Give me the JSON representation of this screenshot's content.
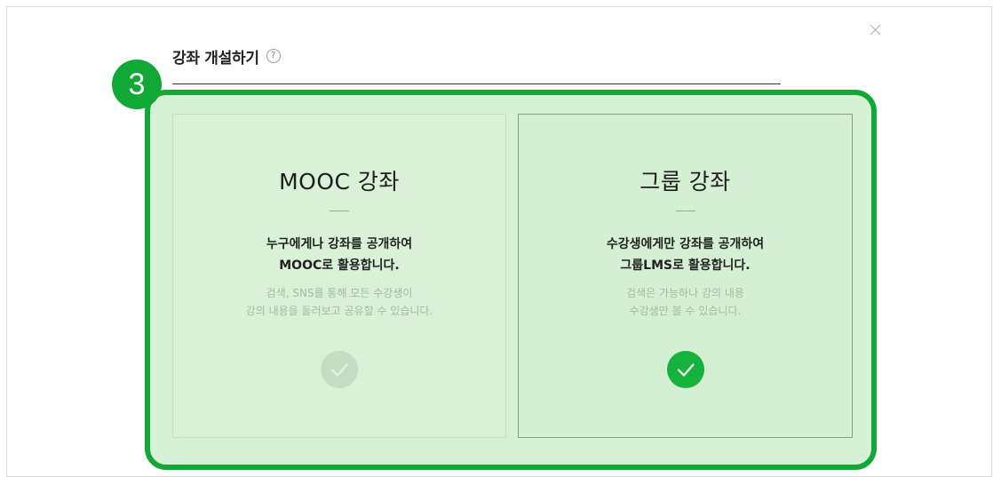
{
  "dialog": {
    "title": "강좌 개설하기",
    "help": "?",
    "step_number": "3",
    "close_icon": "close-icon",
    "accent_color": "#11a837"
  },
  "options": [
    {
      "title": "MOOC 강좌",
      "headline_line1": "누구에게나 강좌를 공개하여",
      "headline_line2": "MOOC로 활용합니다.",
      "desc_line1": "검색, SNS를 통해 모든 수강생이",
      "desc_line2": "강의 내용을 둘러보고 공유할 수 있습니다.",
      "selected": false,
      "icon": "check-icon"
    },
    {
      "title": "그룹 강좌",
      "headline_line1": "수강생에게만 강좌를 공개하여",
      "headline_line2": "그룹LMS로 활용합니다.",
      "desc_line1": "검색은 가능하나 강의 내용",
      "desc_line2": "수강생만 볼 수 있습니다.",
      "selected": true,
      "icon": "check-icon"
    }
  ]
}
